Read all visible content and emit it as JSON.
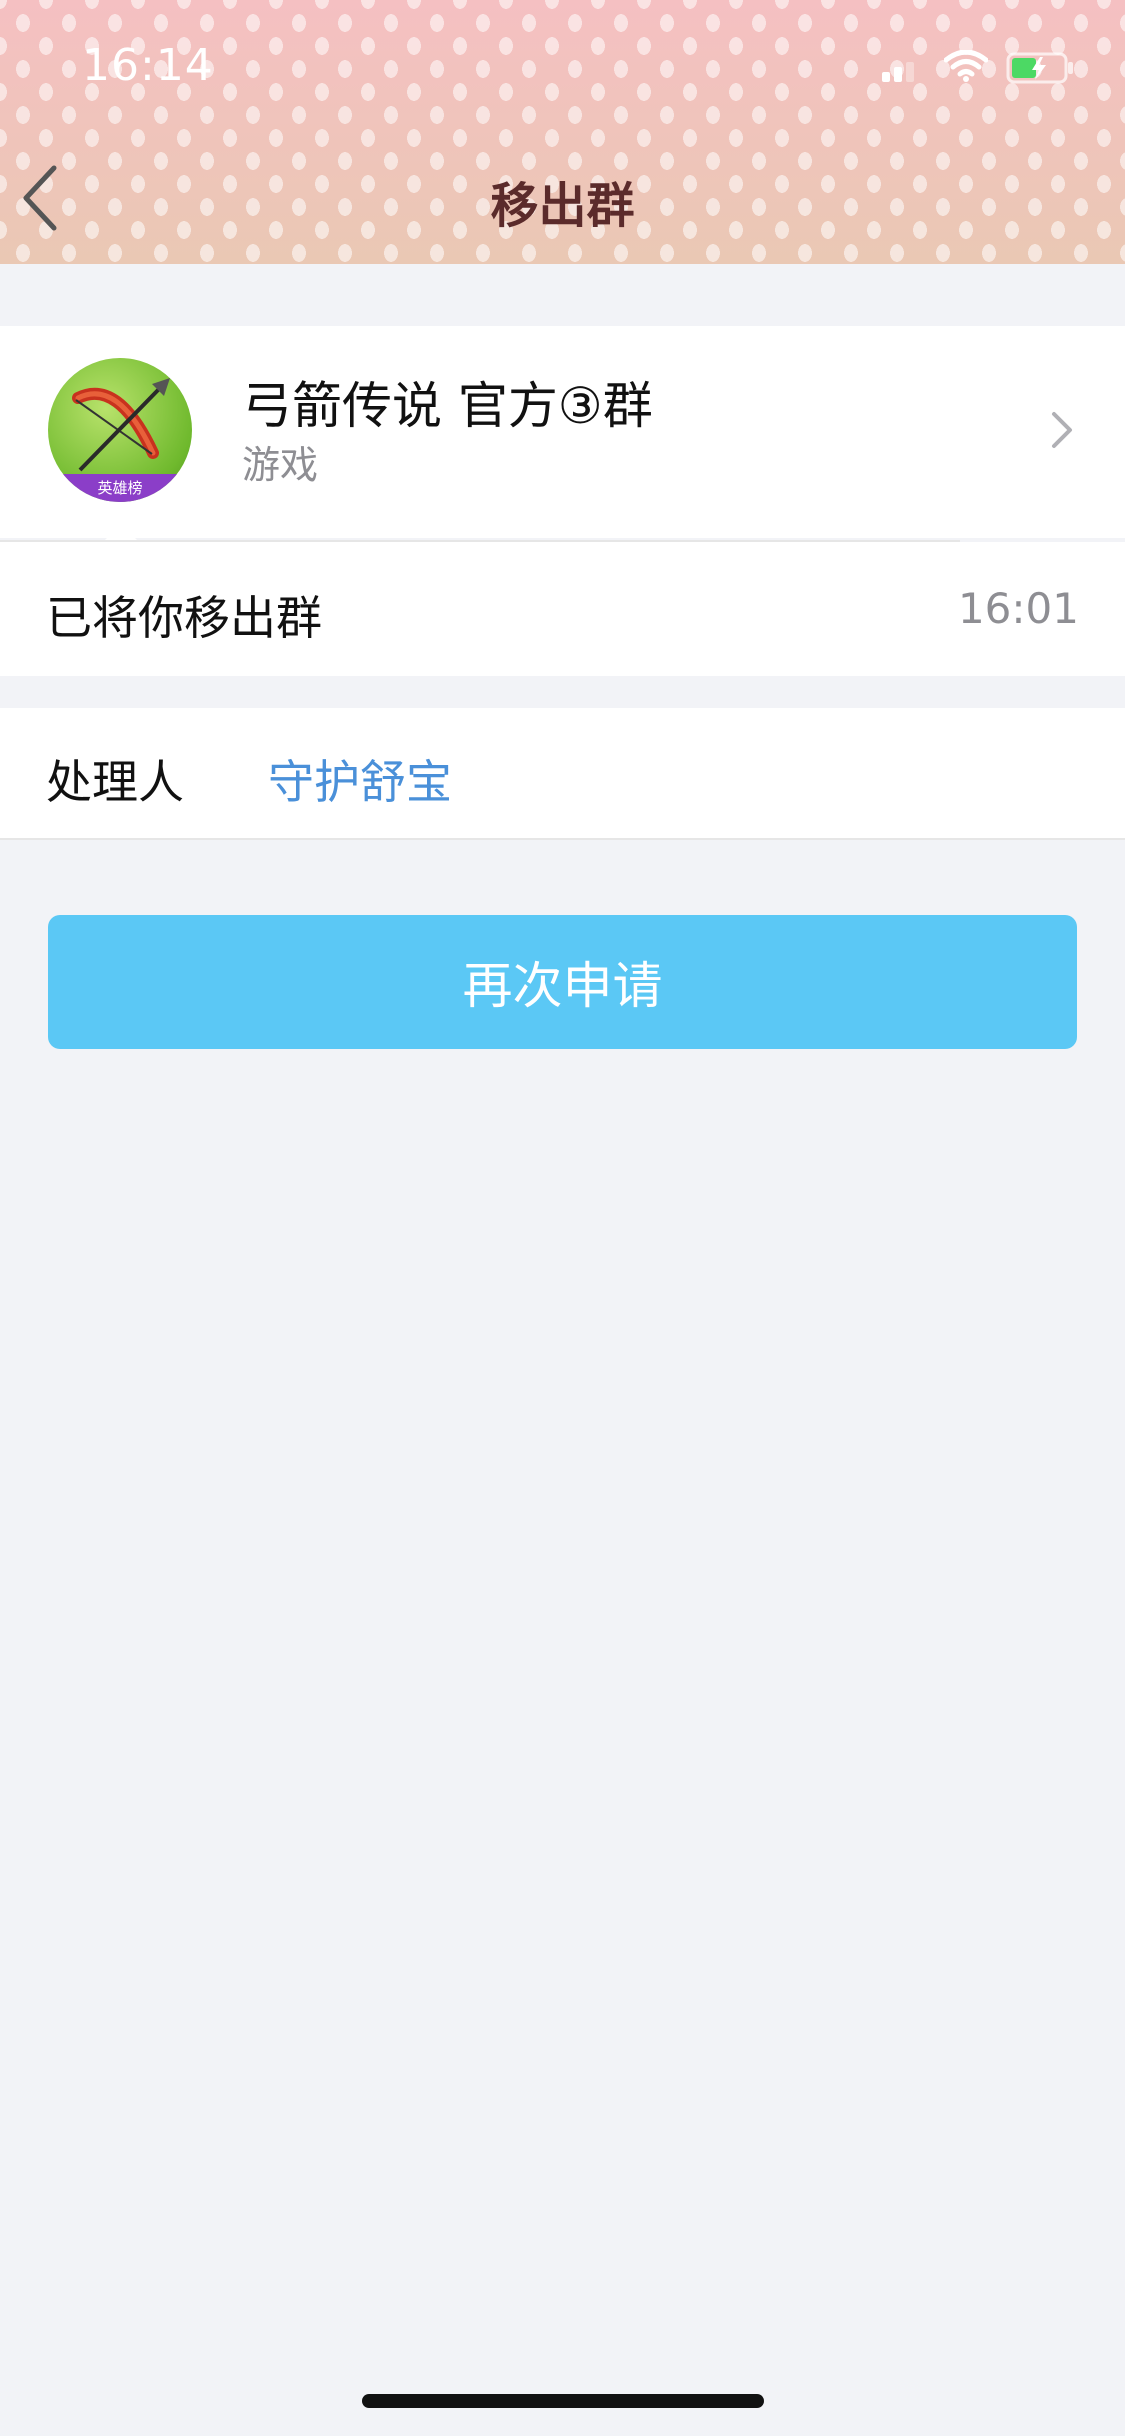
{
  "status_bar": {
    "time": "16:14"
  },
  "header": {
    "title": "移出群"
  },
  "group": {
    "name": "弓箭传说 官方③群",
    "category": "游戏",
    "avatar_badge": "英雄榜"
  },
  "notice": {
    "text": "已将你移出群",
    "time": "16:01"
  },
  "handler": {
    "label": "处理人",
    "name": "守护舒宝"
  },
  "action": {
    "reapply_label": "再次申请"
  },
  "colors": {
    "accent": "#5bc8f5",
    "link": "#4a90d9",
    "background": "#f2f3f7"
  }
}
